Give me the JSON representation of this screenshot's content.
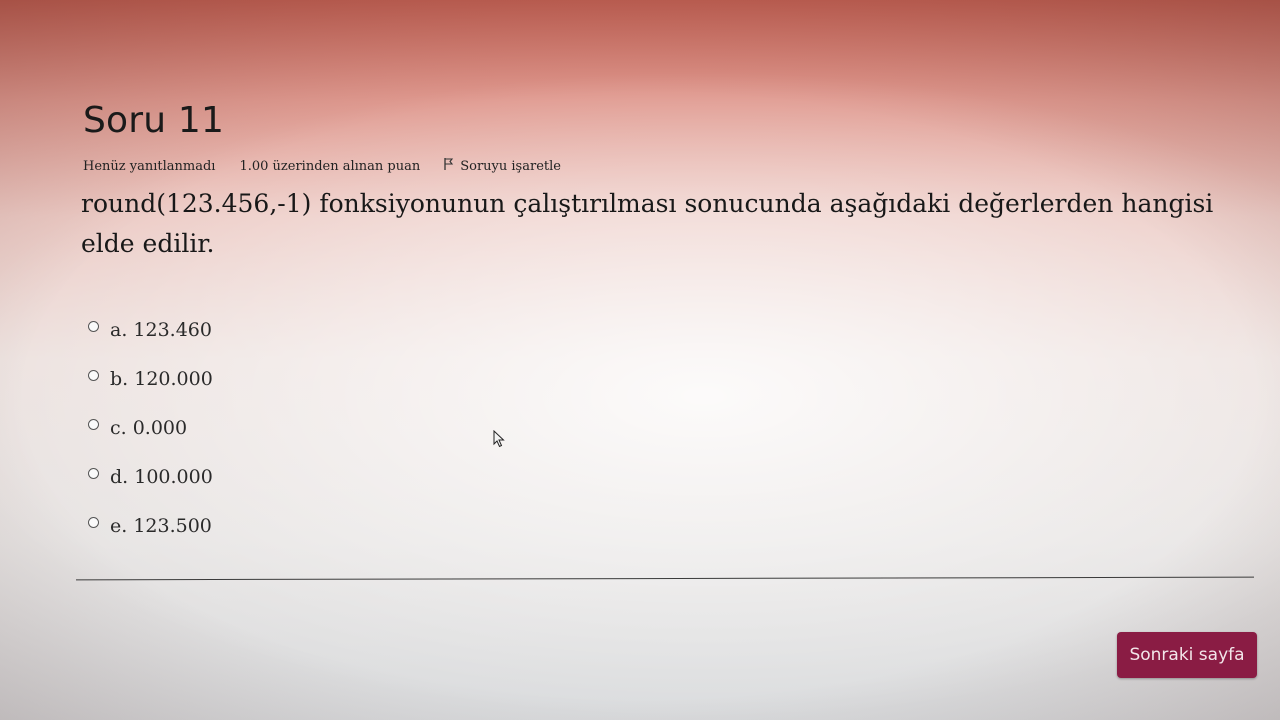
{
  "question": {
    "title": "Soru 11",
    "status": "Henüz yanıtlanmadı",
    "points": "1.00 üzerinden alınan puan",
    "flag_label": "Soruyu işaretle",
    "text": "round(123.456,-1) fonksiyonunun çalıştırılması sonucunda aşağıdaki değerlerden hangisi elde edilir."
  },
  "options": [
    {
      "label": "a. 123.460"
    },
    {
      "label": "b. 120.000"
    },
    {
      "label": "c. 0.000"
    },
    {
      "label": "d. 100.000"
    },
    {
      "label": "e. 123.500"
    }
  ],
  "navigation": {
    "next_label": "Sonraki sayfa"
  },
  "colors": {
    "button_bg": "#8a1c44",
    "button_text": "#f3e6ea"
  },
  "icons": {
    "flag": "flag-icon",
    "radio": "radio-circle",
    "cursor": "mouse-pointer"
  }
}
